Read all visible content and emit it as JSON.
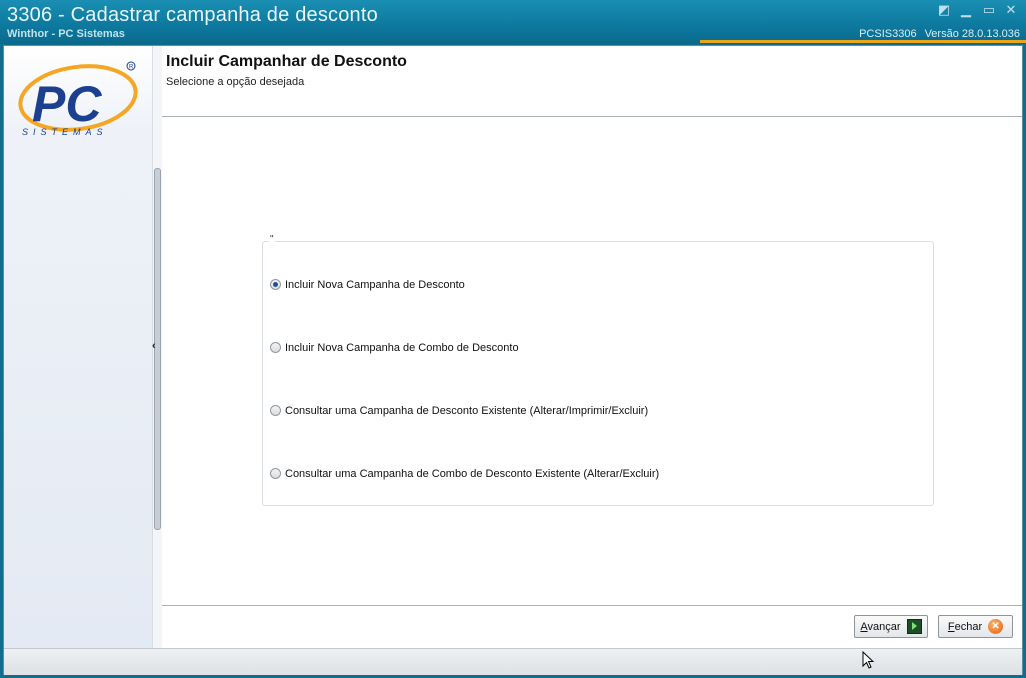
{
  "window": {
    "title": "3306 - Cadastrar campanha de desconto",
    "subtitle": "Winthor - PC Sistemas",
    "routine": "PCSIS3306",
    "version": "Versão  28.0.13.036",
    "controls": [
      "restore-icon",
      "minimize-icon",
      "maximize-icon",
      "close-icon"
    ]
  },
  "logo": {
    "text": "SISTEMAS",
    "accent": "#f5a623",
    "brand": "#1d3f8f"
  },
  "header": {
    "title": "Incluir Campanhar de Desconto",
    "subtitle": "Selecione a opção desejada"
  },
  "options": {
    "caption": "\"",
    "selected_index": 0,
    "items": [
      "Incluir Nova Campanha de Desconto",
      "Incluir Nova Campanha de Combo de Desconto",
      "Consultar uma Campanha de Desconto Existente (Alterar/Imprimir/Excluir)",
      "Consultar uma Campanha de Combo de Desconto Existente (Alterar/Excluir)"
    ]
  },
  "footer": {
    "next_mnemonic": "A",
    "next_rest": "vançar",
    "close_mnemonic": "F",
    "close_rest": "echar"
  }
}
